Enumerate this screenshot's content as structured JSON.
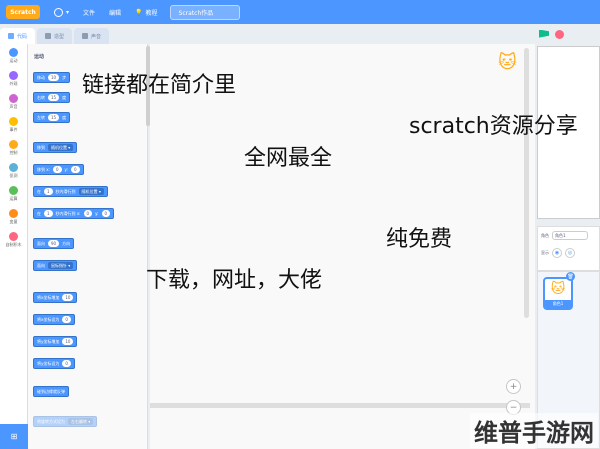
{
  "menubar": {
    "logo": "Scratch",
    "items": [
      "文件",
      "编辑",
      "教程"
    ],
    "project_title": "Scratch作品"
  },
  "tabs": [
    "代码",
    "造型",
    "声音"
  ],
  "categories": [
    {
      "label": "运动",
      "color": "#4c97ff"
    },
    {
      "label": "外观",
      "color": "#9966ff"
    },
    {
      "label": "声音",
      "color": "#cf63cf"
    },
    {
      "label": "事件",
      "color": "#ffbf00"
    },
    {
      "label": "控制",
      "color": "#ffab19"
    },
    {
      "label": "侦测",
      "color": "#5cb1d6"
    },
    {
      "label": "运算",
      "color": "#59c059"
    },
    {
      "label": "变量",
      "color": "#ff8c1a"
    },
    {
      "label": "自制积木",
      "color": "#ff6680"
    }
  ],
  "palette": {
    "title": "运动",
    "blocks": [
      {
        "parts": [
          "移动",
          "10",
          "步"
        ]
      },
      {
        "parts": [
          "右转",
          "15",
          "度"
        ]
      },
      {
        "parts": [
          "左转",
          "15",
          "度"
        ]
      },
      {
        "parts": [
          "移到",
          "随机位置"
        ]
      },
      {
        "parts": [
          "移到 x:",
          "0",
          "y:",
          "0"
        ]
      },
      {
        "parts": [
          "在",
          "1",
          "秒内滑行到",
          "随机位置"
        ]
      },
      {
        "parts": [
          "在",
          "1",
          "秒内滑行到 x:",
          "0",
          "y:",
          "0"
        ]
      },
      {
        "parts": [
          "面向",
          "90",
          "方向"
        ]
      },
      {
        "parts": [
          "面向",
          "鼠标指针"
        ]
      },
      {
        "parts": [
          "将x坐标增加",
          "10"
        ]
      },
      {
        "parts": [
          "将x坐标设为",
          "0"
        ]
      },
      {
        "parts": [
          "将y坐标增加",
          "10"
        ]
      },
      {
        "parts": [
          "将y坐标设为",
          "0"
        ]
      },
      {
        "parts": [
          "碰到边缘就反弹"
        ]
      },
      {
        "parts": [
          "将旋转方式设为",
          "左右翻转"
        ]
      }
    ]
  },
  "overlay_text": {
    "line1": "链接都在简介里",
    "line2": "scratch资源分享",
    "line3": "全网最全",
    "line4": "纯免费",
    "line5": "下载，网址，大佬"
  },
  "sprite_info": {
    "sprite_label": "角色",
    "sprite_name": "角色1",
    "show_label": "显示",
    "card_name": "角色1"
  },
  "watermark": "维普手游网",
  "zoom": {
    "in": "+",
    "out": "−"
  }
}
